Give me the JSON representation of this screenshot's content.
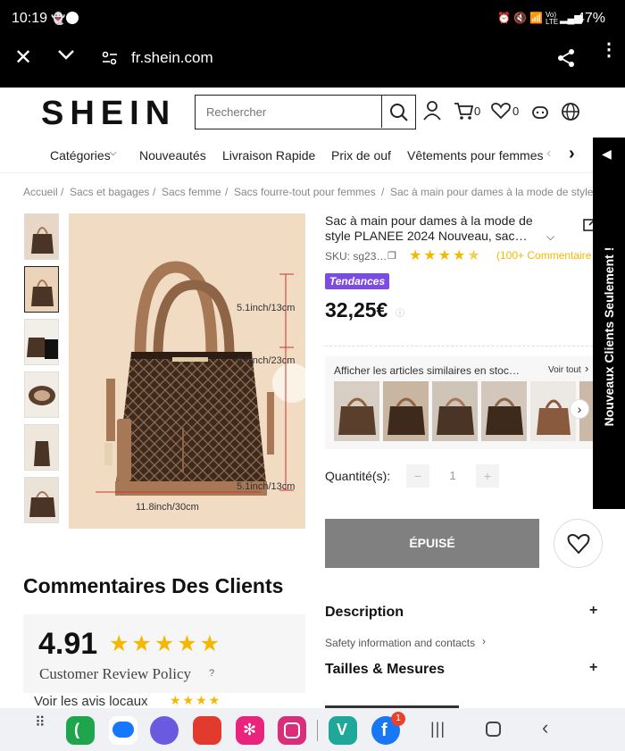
{
  "status_bar": {
    "time": "10:19",
    "battery": "47%",
    "network": "Vo) LTE"
  },
  "browser": {
    "url": "fr.shein.com"
  },
  "header": {
    "logo": "SHEIN",
    "search_placeholder": "Rechercher",
    "cart_count": "0",
    "wishlist_count": "0"
  },
  "nav": {
    "items": [
      "Catégories",
      "Nouveautés",
      "Livraison Rapide",
      "Prix de ouf",
      "Vêtements pour femmes"
    ]
  },
  "breadcrumb": [
    "Accueil",
    "Sacs et bagages",
    "Sacs femme",
    "Sacs fourre-tout pour femmes",
    "Sac à main pour dames à la mode de style"
  ],
  "product": {
    "title": "Sac à main pour dames à la mode de style PLANEE 2024 Nouveau, sac…",
    "sku": "SKU: sg23…",
    "rating": 4.5,
    "review_count": "(100+ Commentaire",
    "badge": "Tendances",
    "price": "32,25€",
    "dimensions": {
      "height_top": "5.1inch/13cm",
      "height_mid": "9.0inch/23cm",
      "height_bottom": "5.1inch/13cm",
      "width": "11.8inch/30cm"
    },
    "similar_label": "Afficher les articles similaires en stoc…",
    "see_all": "Voir tout",
    "quantity_label": "Quantité(s):",
    "quantity_value": "1",
    "minus": "−",
    "plus": "+",
    "sold_out": "ÉPUISÉ"
  },
  "reviews": {
    "heading": "Commentaires Des Clients",
    "score": "4.91",
    "policy": "Customer Review Policy",
    "local_reviews": "Voir les avis locaux"
  },
  "details": {
    "description": "Description",
    "safety": "Safety information and contacts",
    "sizes": "Tailles & Mesures",
    "expand": "+"
  },
  "side_banner": "Nouveaux Clients Seulement !",
  "colors": {
    "accent_star": "#f5b800",
    "badge_purple": "#7b4ce0",
    "soldout_gray": "#808080",
    "bag_brown": "#4a3426",
    "bag_tan": "#a67856"
  },
  "dock": {
    "notification_badge": "1"
  }
}
